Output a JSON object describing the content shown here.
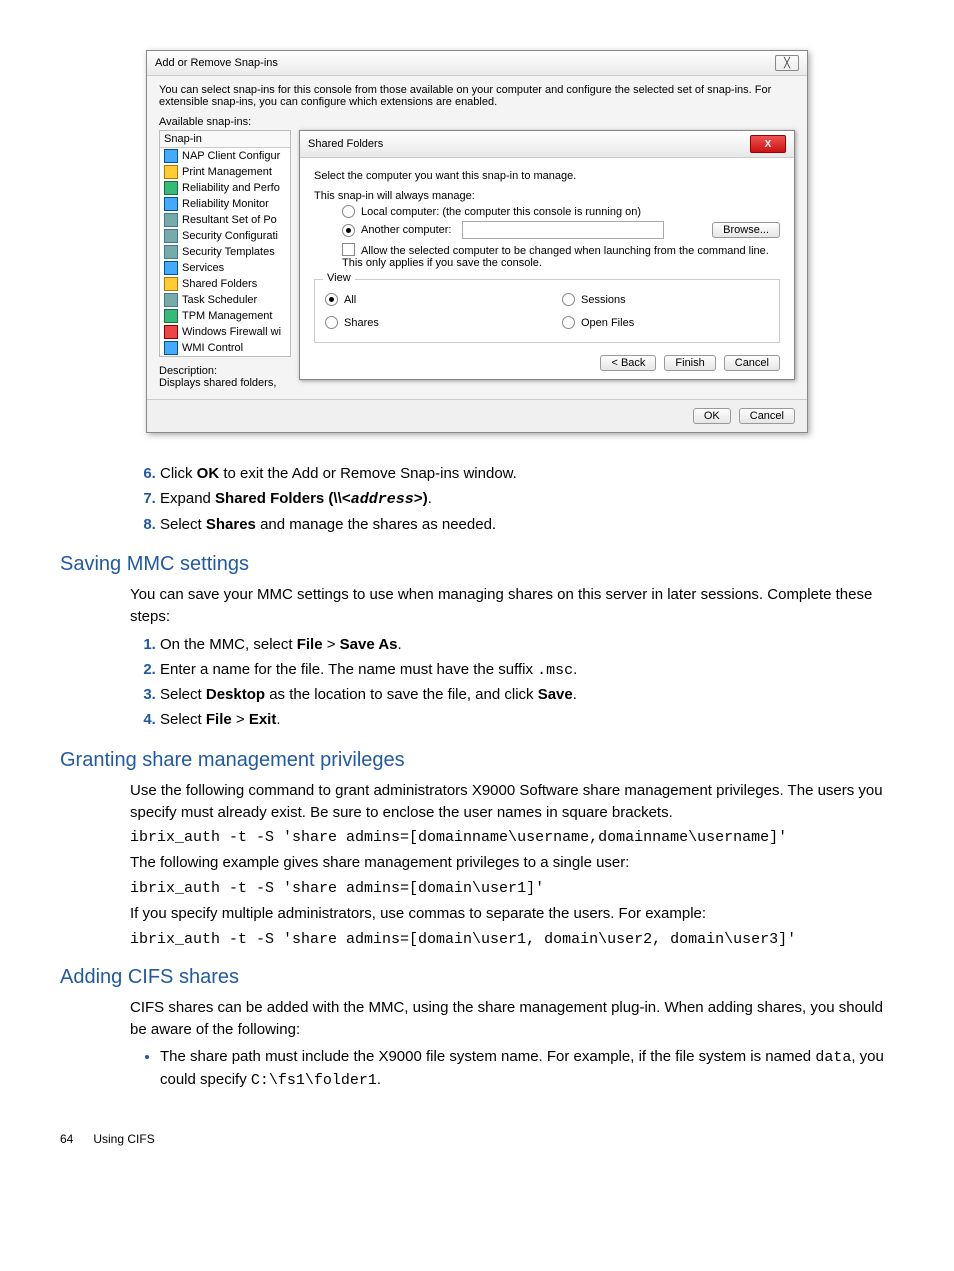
{
  "screenshot": {
    "dialog_title": "Add or Remove Snap-ins",
    "close_glyph": "╳",
    "intro": "You can select snap-ins for this console from those available on your computer and configure the selected set of snap-ins. For extensible snap-ins, you can configure which extensions are enabled.",
    "available_label": "Available snap-ins:",
    "list_header": "Snap-in",
    "snapins": {
      "i0": "NAP Client Configur",
      "i1": "Print Management",
      "i2": "Reliability and Perfo",
      "i3": "Reliability Monitor",
      "i4": "Resultant Set of Po",
      "i5": "Security Configurati",
      "i6": "Security Templates",
      "i7": "Services",
      "i8": "Shared Folders",
      "i9": "Task Scheduler",
      "i10": "TPM Management",
      "i11": "Windows Firewall wi",
      "i12": "WMI Control"
    },
    "desc_label": "Description:",
    "desc_text": "Displays shared folders,",
    "inner": {
      "title": "Shared Folders",
      "close_x": "X",
      "line1": "Select the computer you want this snap-in to manage.",
      "line2": "This snap-in will always manage:",
      "opt_local": "Local computer: (the computer this console is running on)",
      "opt_another": "Another computer:",
      "browse": "Browse...",
      "allow_text": "Allow the selected computer to be changed when launching from the command line. This only applies if you save the console.",
      "view_label": "View",
      "view_all": "All",
      "view_sessions": "Sessions",
      "view_shares": "Shares",
      "view_openfiles": "Open Files",
      "back": "< Back",
      "finish": "Finish",
      "cancel": "Cancel"
    },
    "ok": "OK",
    "cancel": "Cancel"
  },
  "steps_a": {
    "s6a": "Click ",
    "s6b": "OK",
    "s6c": " to exit the Add or Remove Snap-ins window.",
    "s7a": "Expand ",
    "s7b": "Shared Folders (\\\\",
    "s7c": "<address>",
    "s7d": ")",
    "s7e": ".",
    "s8a": "Select ",
    "s8b": "Shares",
    "s8c": " and manage the shares as needed."
  },
  "sec1": {
    "title": "Saving MMC settings",
    "intro": "You can save your MMC settings to use when managing shares on this server in later sessions. Complete these steps:",
    "s1a": "On the MMC, select ",
    "s1b": "File",
    "s1c": " > ",
    "s1d": "Save As",
    "s1e": ".",
    "s2a": "Enter a name for the file. The name must have the suffix ",
    "s2b": ".msc",
    "s2c": ".",
    "s3a": "Select ",
    "s3b": "Desktop",
    "s3c": " as the location to save the file, and click ",
    "s3d": "Save",
    "s3e": ".",
    "s4a": "Select ",
    "s4b": "File",
    "s4c": " > ",
    "s4d": "Exit",
    "s4e": "."
  },
  "sec2": {
    "title": "Granting share management privileges",
    "p1": "Use the following command to grant administrators X9000 Software share management privileges. The users you specify must already exist. Be sure to enclose the user names in square brackets.",
    "cmd1": "ibrix_auth -t -S 'share admins=[domainname\\username,domainname\\username]'",
    "p2": "The following example gives share management privileges to a single user:",
    "cmd2": "ibrix_auth -t -S 'share admins=[domain\\user1]'",
    "p3": "If you specify multiple administrators, use commas to separate the users. For example:",
    "cmd3": "ibrix_auth -t -S 'share admins=[domain\\user1, domain\\user2, domain\\user3]'"
  },
  "sec3": {
    "title": "Adding CIFS shares",
    "p1": "CIFS shares can be added with the MMC, using the share management plug-in. When adding shares, you should be aware of the following:",
    "b1a": "The share path must include the X9000 file system name. For example, if the file system is named ",
    "b1b": "data",
    "b1c": ", you could specify ",
    "b1d": "C:\\fs1\\folder1",
    "b1e": "."
  },
  "footer": {
    "pagenum": "64",
    "chapter": "Using CIFS"
  }
}
